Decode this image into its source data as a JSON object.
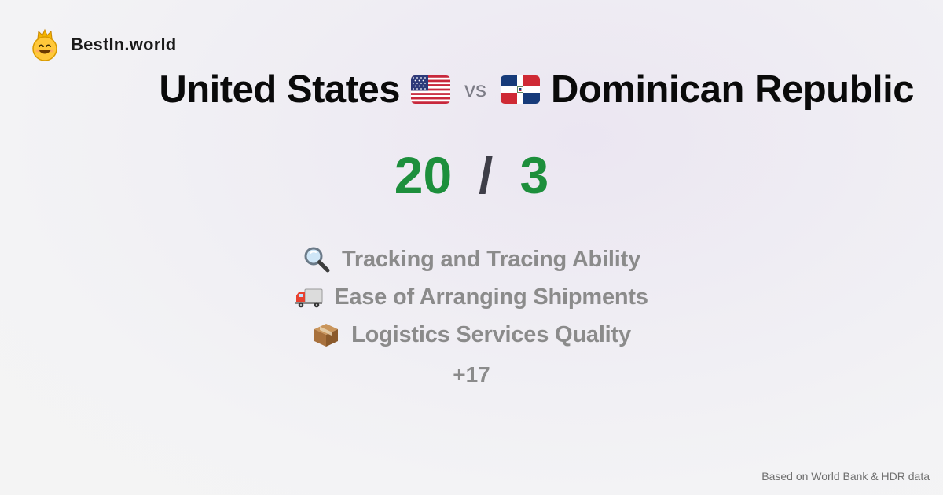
{
  "brand": {
    "name": "BestIn.world",
    "logo_icon": "crowned-smiley-icon"
  },
  "comparison": {
    "left_country": "United States",
    "left_flag_icon": "us-flag-icon",
    "separator": "vs",
    "right_country": "Dominican Republic",
    "right_flag_icon": "dominican-republic-flag-icon"
  },
  "score": {
    "left": "20",
    "separator": "/",
    "right": "3",
    "color": "#1d8f3c"
  },
  "metrics": [
    {
      "icon": "magnifying-glass-icon",
      "label": "Tracking and Tracing Ability"
    },
    {
      "icon": "truck-icon",
      "label": "Ease of Arranging Shipments"
    },
    {
      "icon": "package-icon",
      "label": "Logistics Services Quality"
    }
  ],
  "more_count": "+17",
  "footer": {
    "source": "Based on World Bank & HDR data"
  }
}
